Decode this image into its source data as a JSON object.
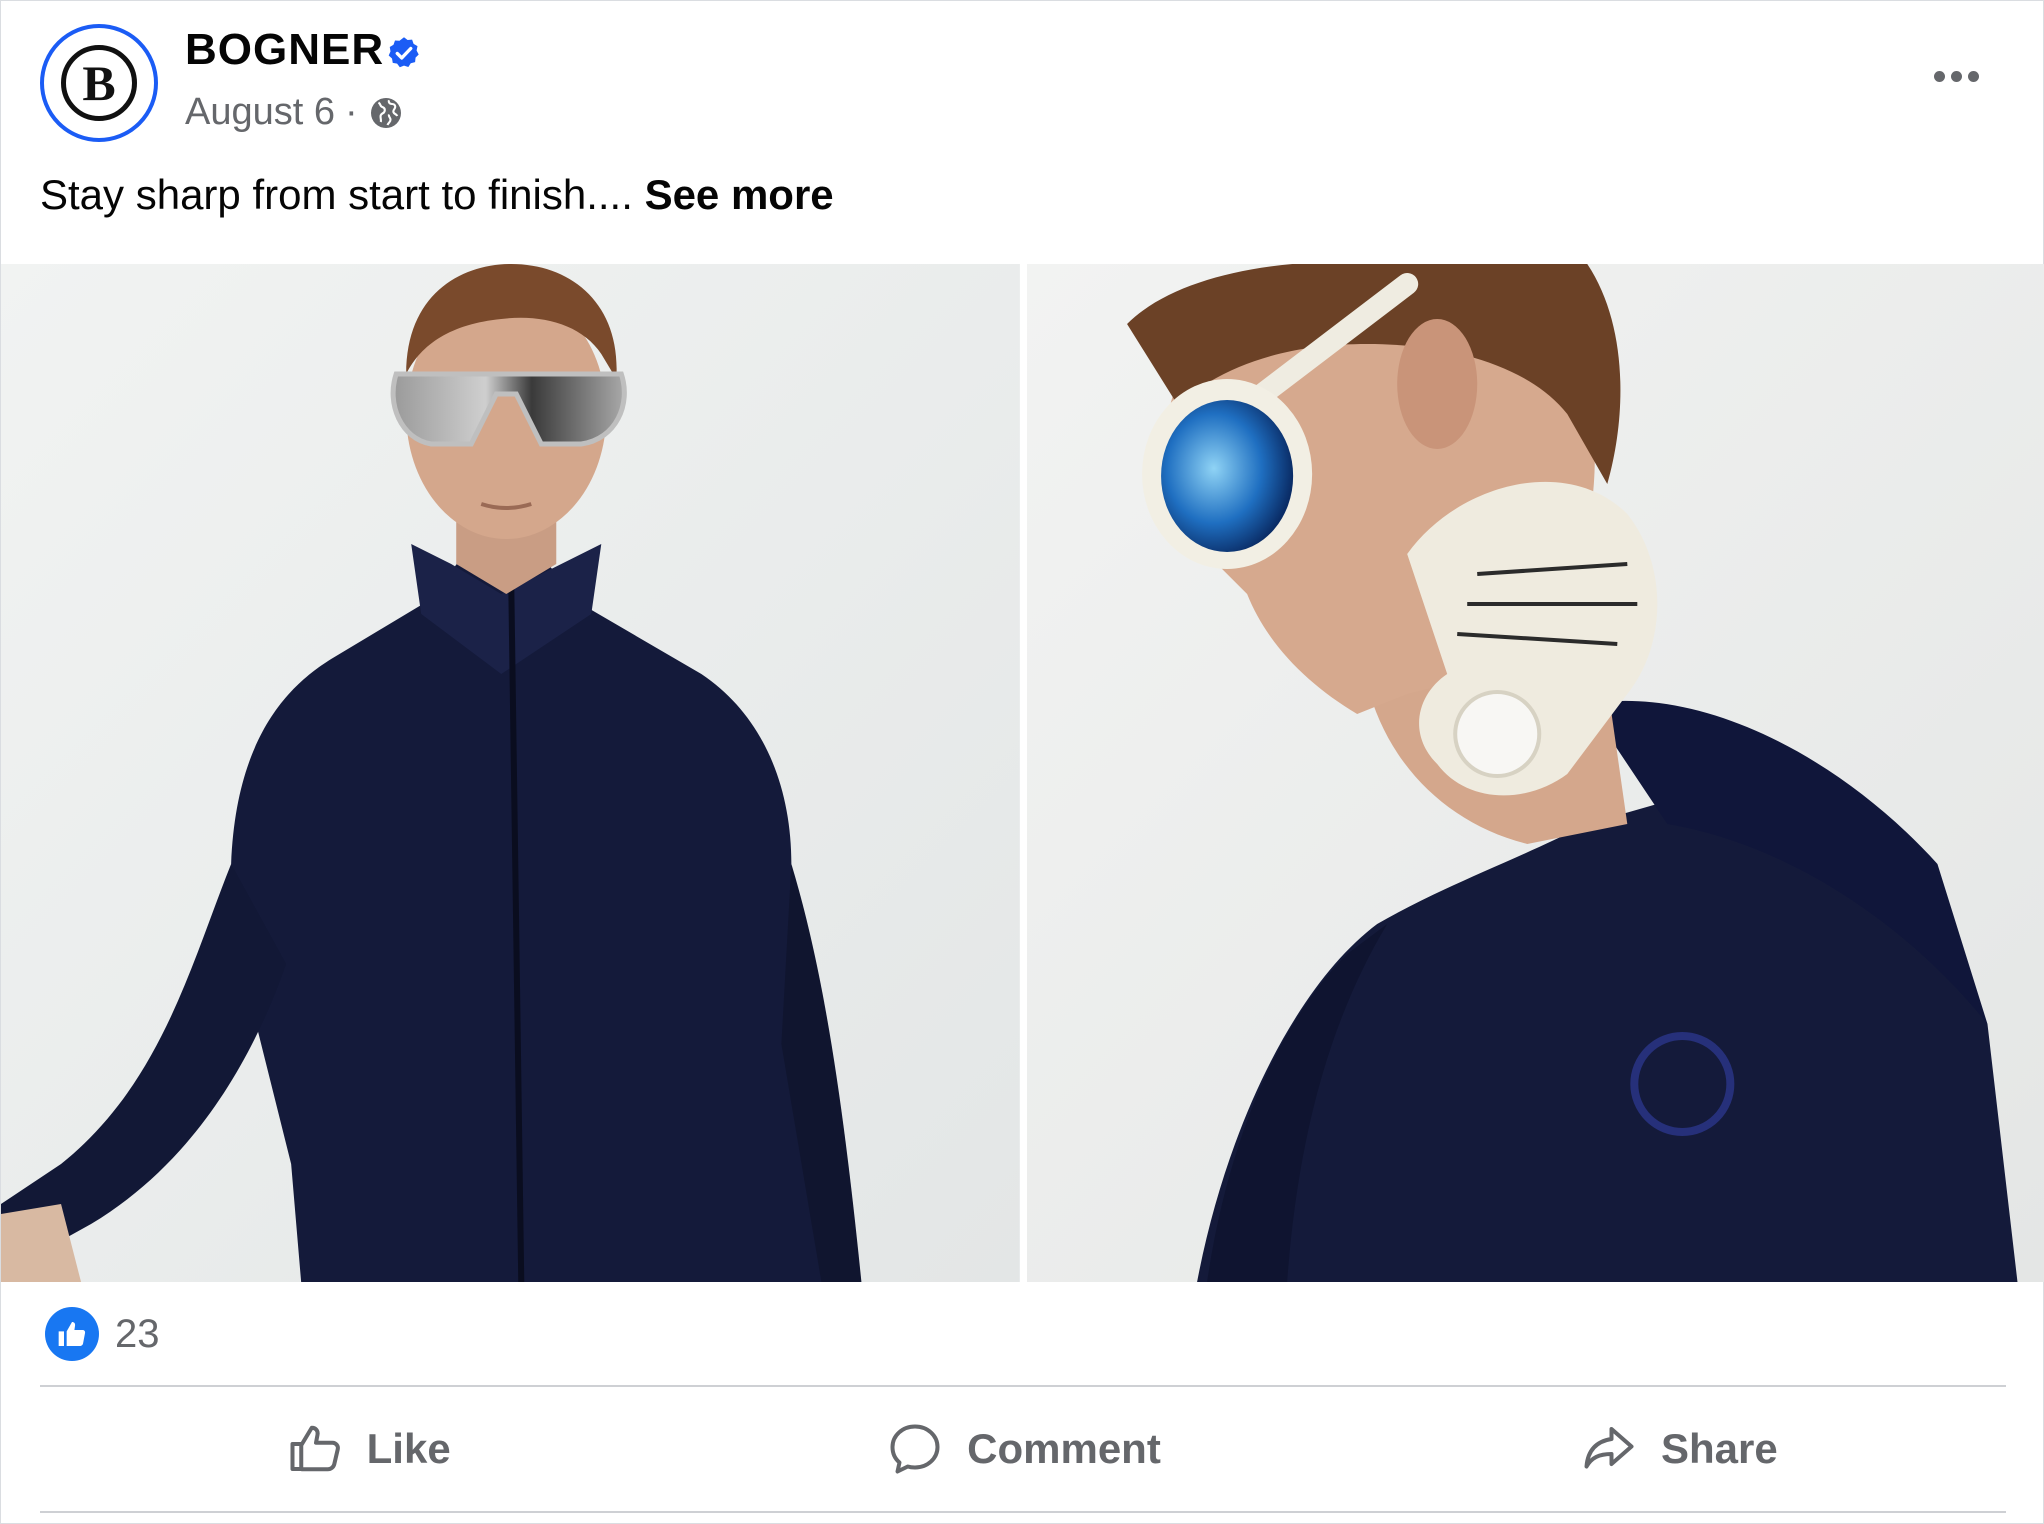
{
  "post": {
    "page_name": "BOGNER",
    "avatar_letter": "B",
    "date": "August 6",
    "separator": "·",
    "audience_icon": "globe-icon",
    "verified_icon": "verified-badge-icon",
    "more_icon": "more-options-icon",
    "caption": "Stay sharp from start to finish....",
    "see_more": "See more",
    "photos": [
      {
        "alt": "Model in navy zip jacket wearing mirrored sunglasses"
      },
      {
        "alt": "Model in navy jacket with white golf glove and round sunglasses"
      }
    ],
    "reactions": {
      "icon": "like-reaction-icon",
      "count": "23"
    },
    "actions": {
      "like": "Like",
      "comment": "Comment",
      "share": "Share"
    }
  },
  "colors": {
    "brand_blue": "#1877f2",
    "avatar_ring": "#1b5cf5",
    "secondary_text": "#65676b",
    "jacket_navy": "#141a3a"
  }
}
